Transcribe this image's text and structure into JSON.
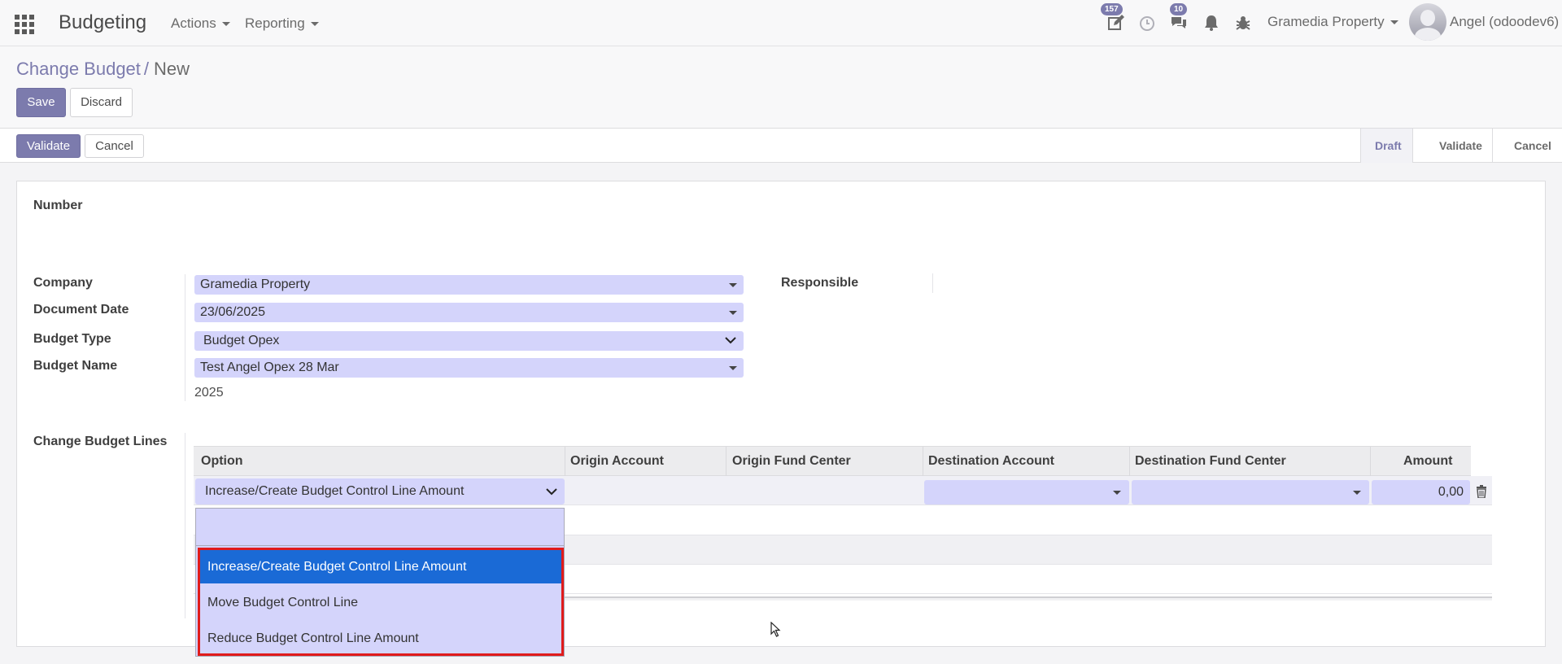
{
  "navbar": {
    "app_title": "Budgeting",
    "menus": [
      "Actions",
      "Reporting"
    ],
    "activity_badge": "157",
    "messages_badge": "10",
    "company": "Gramedia Property",
    "user": "Angel (odoodev6)"
  },
  "breadcrumb": {
    "parent": "Change Budget",
    "separator": "/",
    "current": "New"
  },
  "buttons": {
    "save": "Save",
    "discard": "Discard",
    "validate": "Validate",
    "cancel": "Cancel"
  },
  "status": {
    "steps": [
      "Draft",
      "Validate",
      "Cancel"
    ],
    "active": "Draft"
  },
  "form": {
    "number_label": "Number",
    "company_label": "Company",
    "company_value": "Gramedia Property",
    "date_label": "Document Date",
    "date_value": "23/06/2025",
    "budget_type_label": "Budget Type",
    "budget_type_value": "Budget Opex",
    "budget_name_label": "Budget Name",
    "budget_name_value": "Test Angel Opex 28 Mar",
    "year_value": "2025",
    "responsible_label": "Responsible",
    "lines_label": "Change Budget Lines"
  },
  "table": {
    "columns": [
      "Option",
      "Origin Account",
      "Origin Fund Center",
      "Destination Account",
      "Destination Fund Center",
      "Amount"
    ],
    "row": {
      "option": "Increase/Create Budget Control Line Amount",
      "amount": "0,00"
    }
  },
  "dropdown": {
    "search_value": "",
    "options": [
      "Increase/Create Budget Control Line Amount",
      "Move Budget Control Line",
      "Reduce Budget Control Line Amount"
    ],
    "highlighted_index": 0
  },
  "colors": {
    "accent": "#7c7bad",
    "field_bg": "#d4d4fb",
    "highlight": "#1a6ad6",
    "annotation_box": "#e01b1b"
  }
}
